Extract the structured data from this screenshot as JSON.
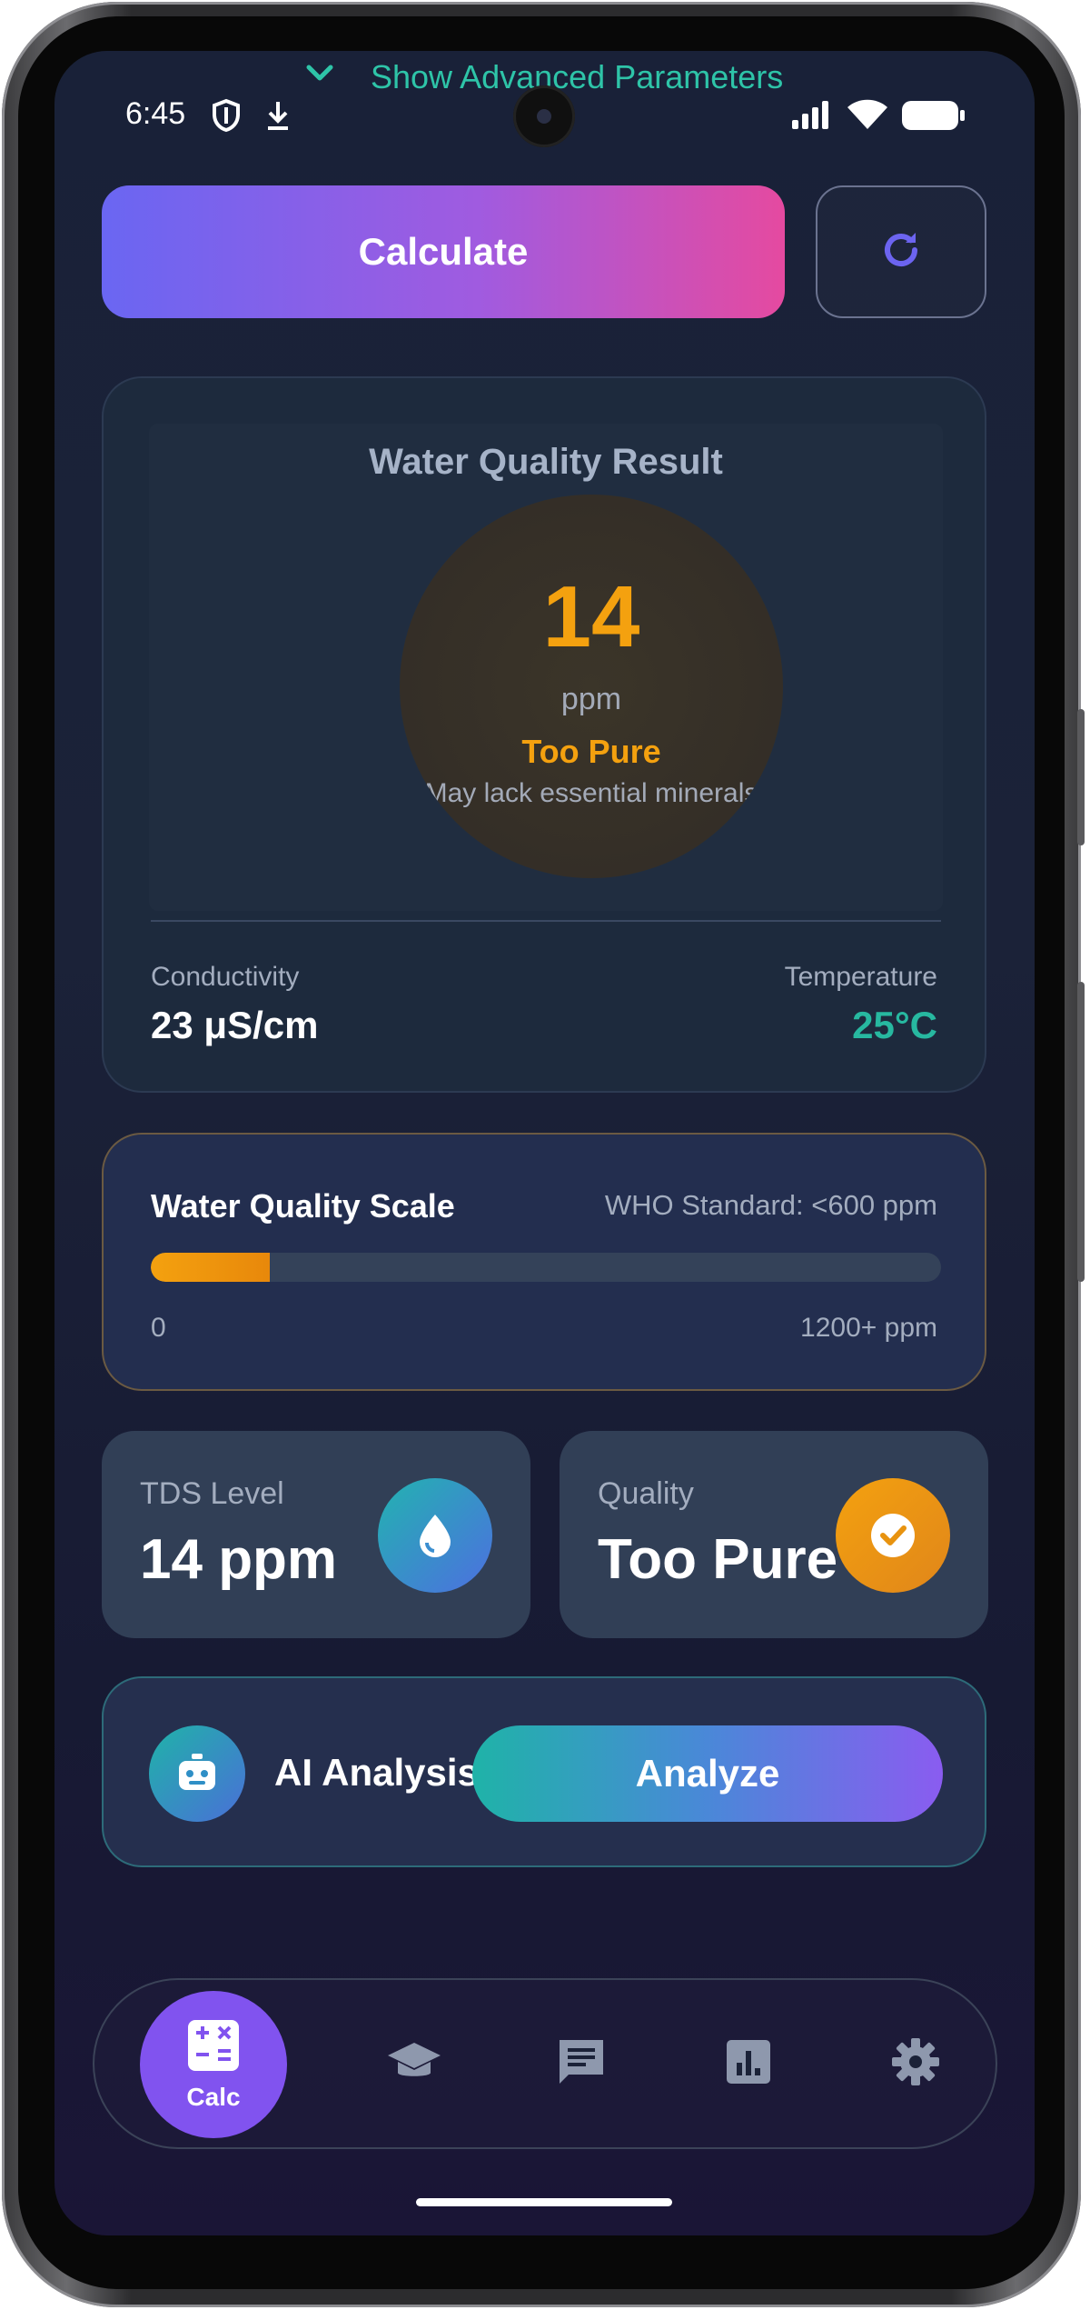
{
  "status_bar": {
    "time": "6:45"
  },
  "header": {
    "advanced_label": "Show Advanced Parameters"
  },
  "actions": {
    "calculate_label": "Calculate"
  },
  "result": {
    "title": "Water Quality Result",
    "value": "14",
    "unit": "ppm",
    "status": "Too Pure",
    "description": "May lack essential minerals",
    "conductivity_label": "Conductivity",
    "conductivity_value": "23 μS/cm",
    "temperature_label": "Temperature",
    "temperature_value": "25°C",
    "status_color": "#f4a10f"
  },
  "scale": {
    "title": "Water Quality Scale",
    "standard": "WHO Standard: <600 ppm",
    "min_label": "0",
    "max_label": "1200+ ppm",
    "level_fraction": 0.15
  },
  "stats": {
    "tds_label": "TDS Level",
    "tds_value": "14 ppm",
    "tds_icon": "water-drop-icon",
    "quality_label": "Quality",
    "quality_value": "Too Pure",
    "quality_icon": "check-circle-icon"
  },
  "ai": {
    "label": "AI Analysis",
    "button_label": "Analyze",
    "icon": "robot-icon"
  },
  "nav": {
    "items": [
      {
        "label": "Calc",
        "icon": "calculator-icon",
        "active": true
      },
      {
        "icon": "graduation-cap-icon"
      },
      {
        "icon": "chat-icon"
      },
      {
        "icon": "bar-chart-icon"
      },
      {
        "icon": "gear-icon"
      }
    ]
  },
  "colors": {
    "accent_teal": "#27b8a0",
    "accent_purple": "#8153ef",
    "warning_orange": "#f4a10f"
  }
}
